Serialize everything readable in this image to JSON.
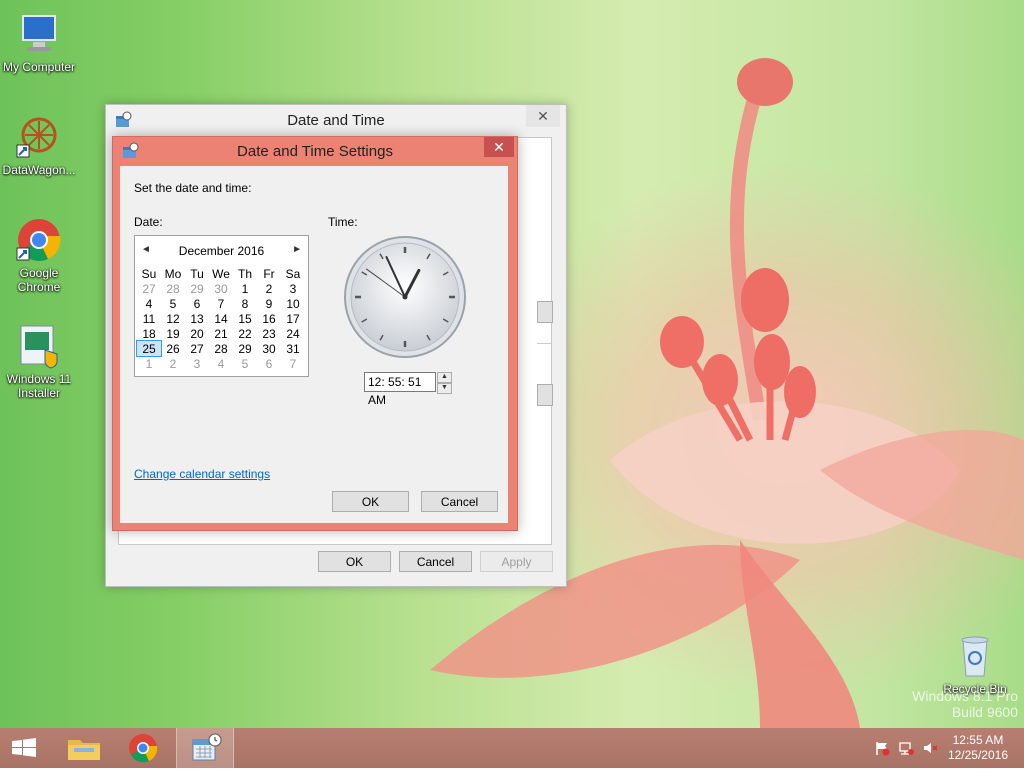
{
  "desktop": {
    "icons": [
      {
        "label": "My Computer"
      },
      {
        "label": "DataWagon..."
      },
      {
        "label": "Google Chrome"
      },
      {
        "label": "Windows 11 Installer"
      },
      {
        "label": "Recycle Bin"
      }
    ],
    "watermark": {
      "line1": "Windows 8.1 Pro",
      "line2": "Build 9600"
    }
  },
  "outer_dialog": {
    "title": "Date and Time",
    "close": "✕",
    "ok_label": "OK",
    "cancel_label": "Cancel",
    "apply_label": "Apply"
  },
  "inner_dialog": {
    "title": "Date and Time Settings",
    "close": "✕",
    "instruction": "Set the date and time:",
    "date_label": "Date:",
    "time_label": "Time:",
    "calendar": {
      "month_year": "December 2016",
      "prev": "◄",
      "next": "►",
      "weekdays": [
        "Su",
        "Mo",
        "Tu",
        "We",
        "Th",
        "Fr",
        "Sa"
      ],
      "weeks": [
        [
          "27",
          "28",
          "29",
          "30",
          "1",
          "2",
          "3"
        ],
        [
          "4",
          "5",
          "6",
          "7",
          "8",
          "9",
          "10"
        ],
        [
          "11",
          "12",
          "13",
          "14",
          "15",
          "16",
          "17"
        ],
        [
          "18",
          "19",
          "20",
          "21",
          "22",
          "23",
          "24"
        ],
        [
          "25",
          "26",
          "27",
          "28",
          "29",
          "30",
          "31"
        ],
        [
          "1",
          "2",
          "3",
          "4",
          "5",
          "6",
          "7"
        ]
      ],
      "selected_day": "25"
    },
    "time_value": "12: 55: 51 AM",
    "clock": {
      "hour": 12,
      "minute": 55,
      "second": 51
    },
    "change_calendar_link": "Change calendar settings",
    "ok_label": "OK",
    "cancel_label": "Cancel"
  },
  "taskbar": {
    "time": "12:55 AM",
    "date": "12/25/2016"
  }
}
